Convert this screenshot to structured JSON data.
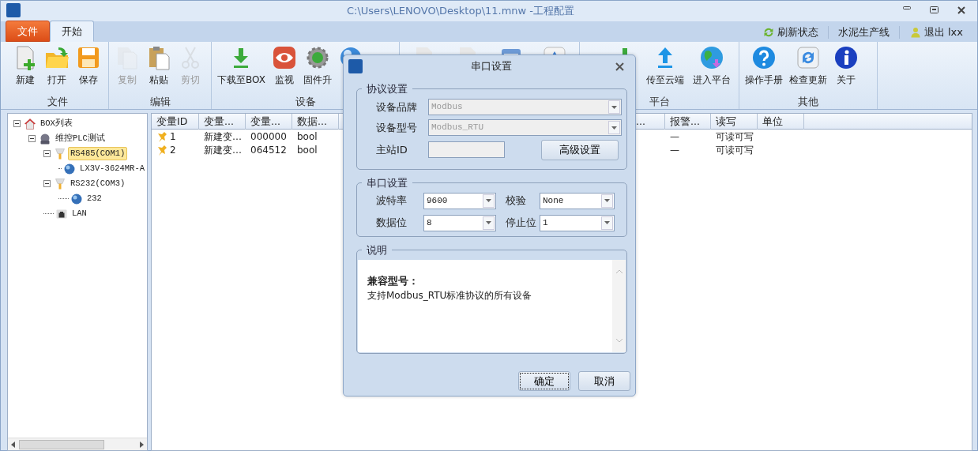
{
  "window": {
    "title": "C:\\Users\\LENOVO\\Desktop\\11.mnw  -工程配置"
  },
  "ribbon_tabs": [
    {
      "label": "文件",
      "kind": "file",
      "selected": false
    },
    {
      "label": "开始",
      "kind": "tab",
      "selected": true
    }
  ],
  "status_links": [
    {
      "label": "刷新状态",
      "kind": "refresh"
    },
    {
      "label": "水泥生产线",
      "kind": "text"
    },
    {
      "label": "退出 lxx",
      "kind": "user"
    }
  ],
  "ribbon_groups": [
    {
      "label": "文件",
      "buttons": [
        {
          "label": "新建",
          "kind": "new",
          "disabled": false
        },
        {
          "label": "打开",
          "kind": "open",
          "disabled": false
        },
        {
          "label": "保存",
          "kind": "save",
          "disabled": false
        }
      ]
    },
    {
      "label": "编辑",
      "buttons": [
        {
          "label": "复制",
          "kind": "copy",
          "disabled": true
        },
        {
          "label": "粘贴",
          "kind": "paste",
          "disabled": false
        },
        {
          "label": "剪切",
          "kind": "cut",
          "disabled": true
        }
      ]
    },
    {
      "label": "设备",
      "buttons": [
        {
          "label": "下载至BOX",
          "kind": "download",
          "disabled": false
        },
        {
          "label": "监视",
          "kind": "eye",
          "disabled": false
        },
        {
          "label": "固件升",
          "kind": "gear",
          "disabled": false
        },
        {
          "kind": "globe"
        }
      ]
    },
    {
      "buttons": [
        {
          "kind": "doc"
        },
        {
          "kind": "doc"
        },
        {
          "kind": "calendar"
        },
        {
          "kind": "up"
        }
      ]
    },
    {
      "label": "平台",
      "buttons": [
        {
          "kind": "bar"
        },
        {
          "label": "传至云端",
          "kind": "upload",
          "disabled": false
        },
        {
          "label": "进入平台",
          "kind": "earth",
          "disabled": false
        }
      ]
    },
    {
      "label": "其他",
      "buttons": [
        {
          "label": "操作手册",
          "kind": "help",
          "disabled": false
        },
        {
          "label": "检查更新",
          "kind": "update",
          "disabled": false
        },
        {
          "label": "关于",
          "kind": "info",
          "disabled": false
        }
      ]
    }
  ],
  "tree": [
    {
      "label": "BOX列表",
      "kind": "home",
      "expanded": true,
      "selected": false,
      "children": [
        {
          "label": "维控PLC测试",
          "kind": "device",
          "expanded": true,
          "selected": false,
          "children": [
            {
              "label": "RS485(COM1)",
              "kind": "port",
              "expanded": true,
              "selected": true,
              "children": [
                {
                  "label": "LX3V-3624MR-A",
                  "kind": "plc",
                  "selected": false
                }
              ]
            },
            {
              "label": "RS232(COM3)",
              "kind": "port",
              "expanded": true,
              "selected": false,
              "children": [
                {
                  "label": "232",
                  "kind": "plc",
                  "selected": false
                }
              ]
            },
            {
              "label": "LAN",
              "kind": "lan",
              "selected": false
            }
          ]
        }
      ]
    }
  ],
  "table": {
    "columns_left": [
      {
        "label": "变量ID",
        "cells": [
          "1",
          "2"
        ]
      },
      {
        "label": "变量...",
        "cells": [
          "新建变…",
          "新建变…"
        ]
      },
      {
        "label": "变量...",
        "cells": [
          "000000",
          "064512"
        ]
      },
      {
        "label": "数据...",
        "cells": [
          "bool",
          "bool"
        ]
      }
    ],
    "columns_right": [
      {
        "label": "..."
      },
      {
        "label": "报警...",
        "cells": [
          "—",
          "—"
        ]
      },
      {
        "label": "读写",
        "cells": [
          "可读可写",
          "可读可写"
        ]
      },
      {
        "label": "单位"
      }
    ]
  },
  "dialog": {
    "title": "串口设置",
    "groups": [
      {
        "title": "协议设置",
        "kind": "form",
        "fields": [
          {
            "label": "设备品牌",
            "kind": "select",
            "value": "Modbus",
            "disabled": true
          },
          {
            "label": "设备型号",
            "kind": "select",
            "value": "Modbus_RTU",
            "disabled": true
          },
          {
            "label": "主站ID",
            "kind": "input",
            "disabled": true
          }
        ],
        "button": "高级设置"
      },
      {
        "title": "串口设置",
        "kind": "grid",
        "fields": [
          {
            "label": "波特率",
            "kind": "select",
            "value": "9600",
            "disabled": false
          },
          {
            "label": "校验",
            "kind": "select",
            "value": "None",
            "disabled": false
          },
          {
            "label": "数据位",
            "kind": "select",
            "value": "8",
            "disabled": false
          },
          {
            "label": "停止位",
            "kind": "select",
            "value": "1",
            "disabled": false
          }
        ]
      },
      {
        "title": "说明",
        "kind": "note",
        "heading": "兼容型号：",
        "text": "支持Modbus_RTU标准协议的所有设备"
      }
    ],
    "buttons": [
      {
        "label": "确定",
        "focused": true
      },
      {
        "label": "取消",
        "focused": false
      }
    ]
  }
}
